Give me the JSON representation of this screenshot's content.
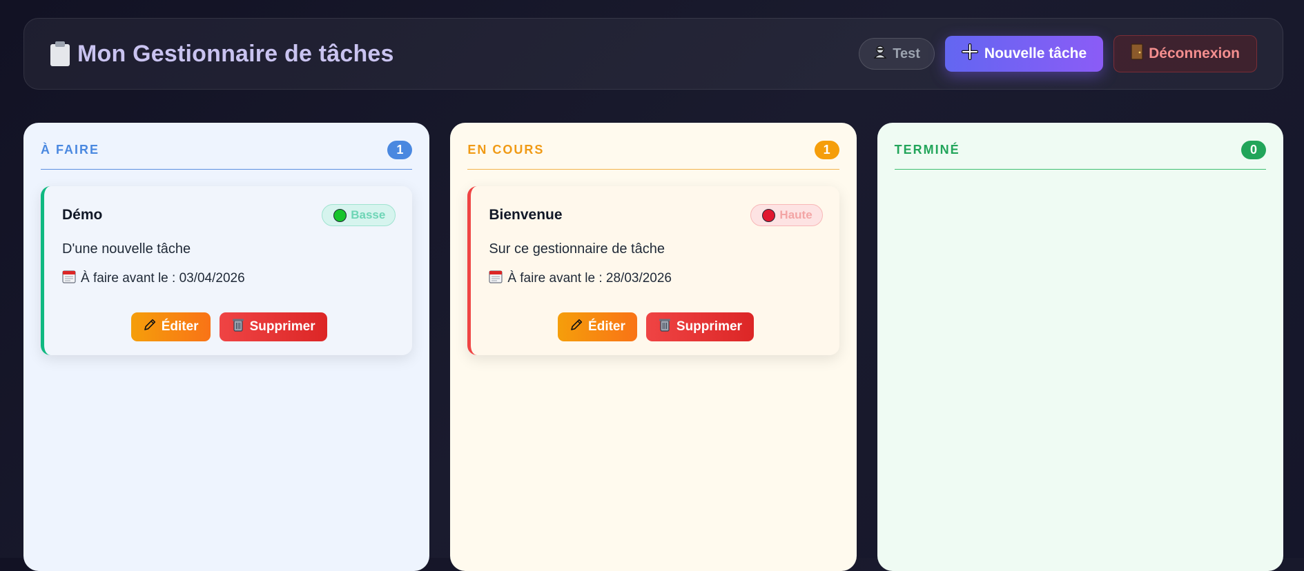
{
  "header": {
    "title": "Mon Gestionnaire de tâches",
    "user_label": "Test",
    "new_task_label": "Nouvelle tâche",
    "logout_label": "Déconnexion"
  },
  "columns": [
    {
      "title": "À FAIRE",
      "count": "1",
      "color": "#4a88e0",
      "cards": [
        {
          "title": "Démo",
          "priority": "Basse",
          "priority_color": "#16c42b",
          "description": "D'une nouvelle tâche",
          "due": "À faire avant le : 03/04/2026",
          "edit_label": "Éditer",
          "delete_label": "Supprimer"
        }
      ]
    },
    {
      "title": "EN COURS",
      "count": "1",
      "color": "#f59e0b",
      "cards": [
        {
          "title": "Bienvenue",
          "priority": "Haute",
          "priority_color": "#e0182f",
          "description": "Sur ce gestionnaire de tâche",
          "due": "À faire avant le : 28/03/2026",
          "edit_label": "Éditer",
          "delete_label": "Supprimer"
        }
      ]
    },
    {
      "title": "TERMINÉ",
      "count": "0",
      "color": "#22a55a",
      "cards": []
    }
  ],
  "icons": {
    "title": "clipboard-icon",
    "user": "user-icon",
    "new_task": "plus-icon",
    "logout": "door-icon",
    "due": "calendar-icon",
    "edit": "pencil-icon",
    "delete": "trash-icon"
  }
}
